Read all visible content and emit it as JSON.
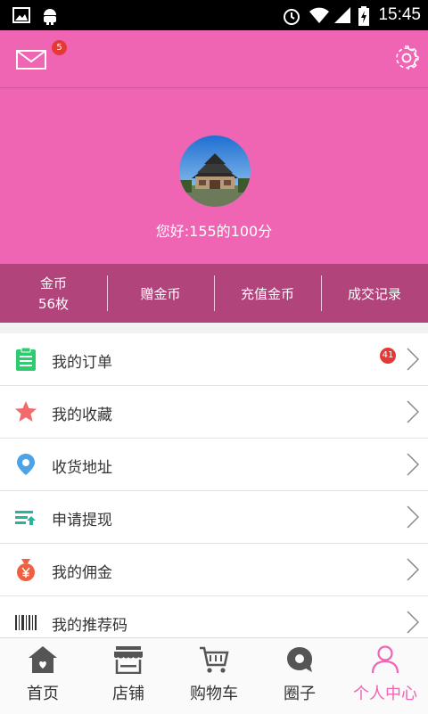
{
  "status_bar": {
    "time": "15:45"
  },
  "header": {
    "mail_badge": "5",
    "greeting": "您好:155的100分"
  },
  "stats": [
    {
      "line1": "金币",
      "line2": "56枚"
    },
    {
      "line1": "赠金币"
    },
    {
      "line1": "充值金币"
    },
    {
      "line1": "成交记录"
    }
  ],
  "menu": [
    {
      "label": "我的订单",
      "icon": "clipboard-icon",
      "badge": "41",
      "color": "#2ecc71"
    },
    {
      "label": "我的收藏",
      "icon": "star-icon",
      "color": "#f06c6c"
    },
    {
      "label": "收货地址",
      "icon": "location-pin-icon",
      "color": "#4da3e8"
    },
    {
      "label": "申请提现",
      "icon": "withdraw-icon",
      "color": "#26b59a"
    },
    {
      "label": "我的佣金",
      "icon": "money-bag-icon",
      "color": "#f06040"
    },
    {
      "label": "我的推荐码",
      "icon": "barcode-icon",
      "color": "#333333"
    }
  ],
  "nav": [
    {
      "label": "首页",
      "icon": "home-icon"
    },
    {
      "label": "店铺",
      "icon": "store-icon"
    },
    {
      "label": "购物车",
      "icon": "cart-icon"
    },
    {
      "label": "圈子",
      "icon": "chat-bubble-icon"
    },
    {
      "label": "个人中心",
      "icon": "person-icon",
      "active": true
    }
  ],
  "colors": {
    "header": "#f064b4",
    "stats_bar": "#b2447c",
    "active_nav": "#f064b4"
  }
}
